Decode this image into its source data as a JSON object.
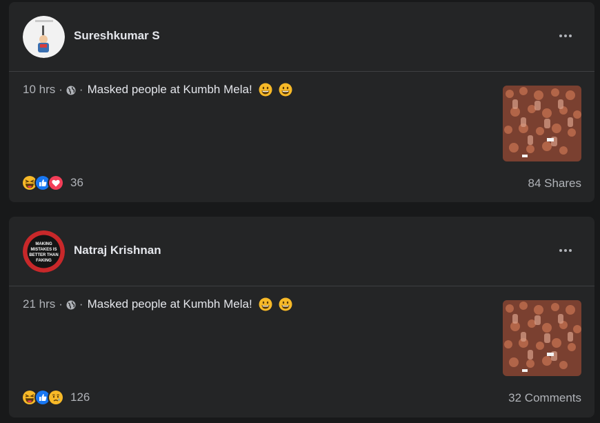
{
  "posts": [
    {
      "author": "Sureshkumar S",
      "time": "10 hrs",
      "separator": "·",
      "text": "Masked people at Kumbh Mela!",
      "reaction_count": "36",
      "stat": "84 Shares",
      "reactions": [
        "haha",
        "like",
        "love"
      ]
    },
    {
      "author": "Natraj Krishnan",
      "time": "21 hrs",
      "separator": "·",
      "text": "Masked people at Kumbh Mela!",
      "reaction_count": "126",
      "stat": "32 Comments",
      "reactions": [
        "haha",
        "like",
        "sad"
      ],
      "avatar_text": "MAKING MISTAKES IS BETTER THAN FAKING"
    }
  ],
  "colors": {
    "background": "#18191a",
    "card": "#242526",
    "primary_text": "#e4e6eb",
    "secondary_text": "#b0b3b8",
    "like": "#1877f2",
    "love": "#f33e58",
    "emoji_yellow": "#f7b928"
  },
  "icons": [
    "more-options-icon",
    "globe-icon",
    "grinning-emoji-icon",
    "haha-reaction-icon",
    "like-reaction-icon",
    "love-reaction-icon",
    "sad-reaction-icon"
  ]
}
